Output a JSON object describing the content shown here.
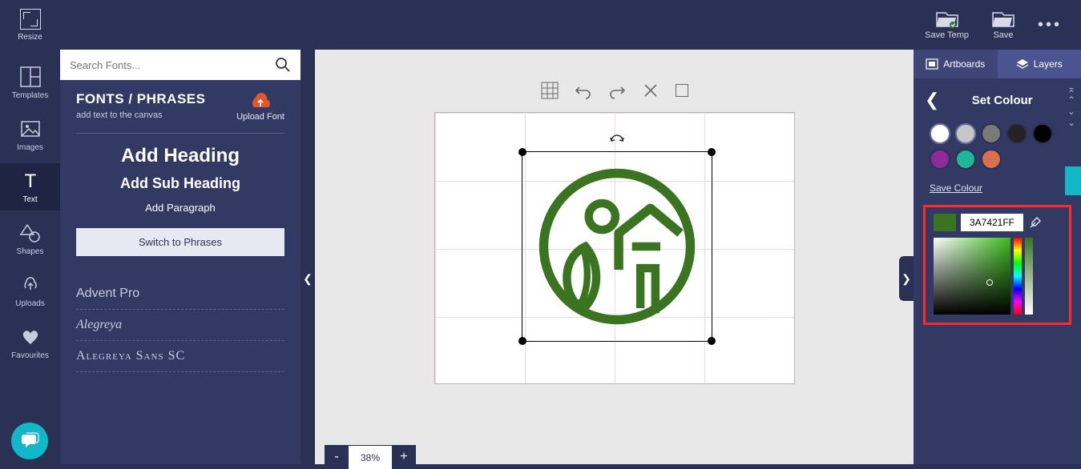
{
  "topbar": {
    "resize_label": "Resize",
    "save_temp_label": "Save Temp",
    "save_label": "Save"
  },
  "leftrail": {
    "templates": "Templates",
    "images": "Images",
    "text": "Text",
    "shapes": "Shapes",
    "uploads": "Uploads",
    "favourites": "Favourites"
  },
  "fonts_panel": {
    "search_placeholder": "Search Fonts...",
    "heading": "FONTS / PHRASES",
    "subheading": "add text to the canvas",
    "upload_font_label": "Upload Font",
    "add_heading": "Add Heading",
    "add_subheading": "Add Sub Heading",
    "add_paragraph": "Add Paragraph",
    "switch_btn": "Switch to Phrases",
    "fonts": [
      "Advent Pro",
      "Alegreya",
      "Alegreya Sans SC"
    ]
  },
  "zoom": {
    "value": "38%"
  },
  "right": {
    "tab_artboards": "Artboards",
    "tab_layers": "Layers",
    "title": "Set Colour",
    "save_colour": "Save Colour",
    "hex": "3A7421FF",
    "swatches": [
      "#ffffff",
      "#c6c6c6",
      "#7a7a7a",
      "#232323",
      "#000000",
      "#8e2a9a",
      "#1fb79a",
      "#d7704f"
    ]
  }
}
